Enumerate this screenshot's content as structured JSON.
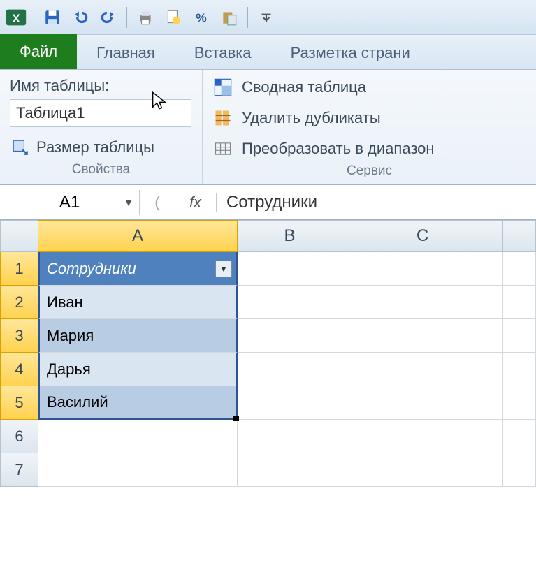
{
  "tabs": {
    "file": "Файл",
    "home": "Главная",
    "insert": "Вставка",
    "pageLayout": "Разметка страни"
  },
  "ribbon": {
    "properties": {
      "tableNameLabel": "Имя таблицы:",
      "tableNameValue": "Таблица1",
      "resizeTable": "Размер таблицы",
      "groupLabel": "Свойства"
    },
    "service": {
      "pivot": "Сводная таблица",
      "removeDup": "Удалить дубликаты",
      "convertRange": "Преобразовать в диапазон",
      "groupLabel": "Сервис"
    }
  },
  "formulaBar": {
    "nameBox": "A1",
    "fx": "fx",
    "content": "Сотрудники"
  },
  "columns": {
    "A": "A",
    "B": "B",
    "C": "C"
  },
  "rows": {
    "r1": "1",
    "r2": "2",
    "r3": "3",
    "r4": "4",
    "r5": "5",
    "r6": "6",
    "r7": "7"
  },
  "table": {
    "header": "Сотрудники",
    "data": [
      "Иван",
      "Мария",
      "Дарья",
      "Василий"
    ]
  }
}
